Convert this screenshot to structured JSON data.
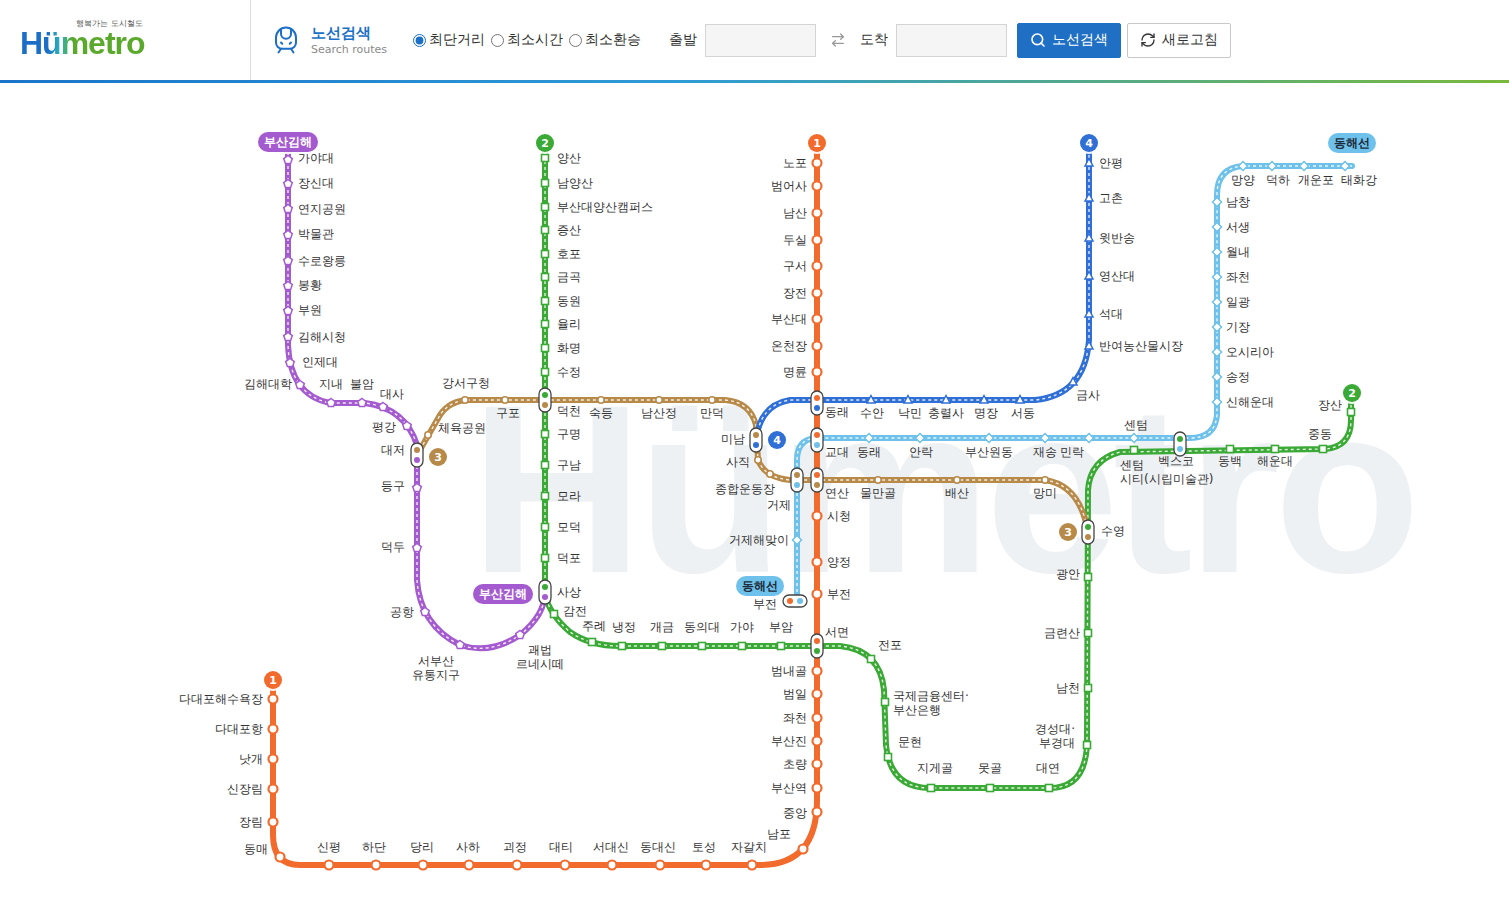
{
  "header": {
    "logo": {
      "brand": "Hümetro",
      "tagline": "행복가는 도시철도"
    },
    "search": {
      "title": "노선검색",
      "subtitle": "Search routes",
      "options": [
        {
          "label": "최단거리",
          "selected": true
        },
        {
          "label": "최소시간",
          "selected": false
        },
        {
          "label": "최소환승",
          "selected": false
        }
      ],
      "from": {
        "label": "출발",
        "value": ""
      },
      "to": {
        "label": "도착",
        "value": ""
      },
      "buttons": [
        {
          "label": "노선검색",
          "kind": "primary"
        },
        {
          "label": "새로고침",
          "kind": "secondary"
        }
      ]
    }
  },
  "map": {
    "watermark": "Hümetro",
    "lines": [
      {
        "id": "1",
        "badge": "1",
        "color": "#f26b2d",
        "kind": "circle",
        "stations": [
          "노포",
          "범어사",
          "남산",
          "두실",
          "구서",
          "장전",
          "부산대",
          "온천장",
          "명륜",
          "동래",
          "교대",
          "연산",
          "시청",
          "양정",
          "부전",
          "서면",
          "범내골",
          "범일",
          "좌천",
          "부산진",
          "초량",
          "부산역",
          "중앙",
          "남포",
          "자갈치",
          "토성",
          "동대신",
          "서대신",
          "대티",
          "괴정",
          "사하",
          "당리",
          "하단",
          "신평",
          "동매",
          "장림",
          "신장림",
          "낫개",
          "다대포항",
          "다대포해수욕장"
        ]
      },
      {
        "id": "2",
        "badge": "2",
        "color": "#3aa935",
        "kind": "square",
        "stations": [
          "양산",
          "남양산",
          "부산대양산캠퍼스",
          "증산",
          "호포",
          "금곡",
          "동원",
          "율리",
          "화명",
          "수정",
          "덕천",
          "구명",
          "구남",
          "모라",
          "모덕",
          "덕포",
          "사상",
          "감전",
          "주례",
          "냉정",
          "개금",
          "동의대",
          "가야",
          "부암",
          "전포",
          "국제금융센터·\n부산은행",
          "문현",
          "지게골",
          "못골",
          "대연",
          "경성대·\n부경대",
          "남천",
          "금련산",
          "광안",
          "수영",
          "센텀\n시티(시립미술관)",
          "동백",
          "해운대",
          "중동",
          "장산"
        ]
      },
      {
        "id": "3",
        "badge": "3",
        "color": "#b88a4a",
        "kind": "dot",
        "stations": [
          "체육공원",
          "강서구청",
          "구포",
          "숙등",
          "남산정",
          "만덕",
          "사직",
          "종합운동장",
          "물만골",
          "배산",
          "망미"
        ]
      },
      {
        "id": "4",
        "badge": "4",
        "color": "#2f6fd6",
        "kind": "triangle",
        "stations": [
          "안평",
          "고촌",
          "윗반송",
          "영산대",
          "석대",
          "반여농산물시장",
          "금사",
          "서동",
          "명장",
          "충렬사",
          "낙민",
          "수안",
          "미남"
        ]
      },
      {
        "id": "동해선",
        "badge": "동해선",
        "color": "#6ec1ea",
        "kind": "diamond",
        "stations": [
          "태화강",
          "개운포",
          "덕하",
          "망양",
          "남창",
          "서생",
          "월내",
          "좌천",
          "일광",
          "기장",
          "오시리아",
          "송정",
          "신해운대",
          "벡스코",
          "센텀",
          "민락",
          "재송",
          "부산원동",
          "안락",
          "동래",
          "거제",
          "거제해맞이",
          "부전"
        ]
      },
      {
        "id": "부산김해",
        "badge": "부산김해",
        "color": "#a55bd0",
        "kind": "pentagon",
        "stations": [
          "가야대",
          "장신대",
          "연지공원",
          "박물관",
          "수로왕릉",
          "봉황",
          "부원",
          "김해시청",
          "인제대",
          "김해대학",
          "지내",
          "불암",
          "대사",
          "평강",
          "대저",
          "등구",
          "덕두",
          "공항",
          "서부산\n유통지구",
          "괘법\n르네시떼"
        ]
      }
    ],
    "transfers": [
      {
        "lines": [
          "1",
          "4"
        ]
      },
      {
        "lines": [
          "1",
          "동해선"
        ]
      },
      {
        "lines": [
          "1",
          "3"
        ]
      },
      {
        "lines": [
          "3",
          "동해선"
        ]
      },
      {
        "lines": [
          "1",
          "2"
        ]
      },
      {
        "lines": [
          "2",
          "3"
        ]
      },
      {
        "lines": [
          "2",
          "부산김해"
        ]
      },
      {
        "lines": [
          "3",
          "부산김해"
        ]
      },
      {
        "lines": [
          "3",
          "4"
        ]
      },
      {
        "lines": [
          "2",
          "3"
        ]
      },
      {
        "lines": [
          "2",
          "동해선"
        ]
      },
      {
        "lines": [
          "1",
          "동해선"
        ]
      }
    ]
  }
}
